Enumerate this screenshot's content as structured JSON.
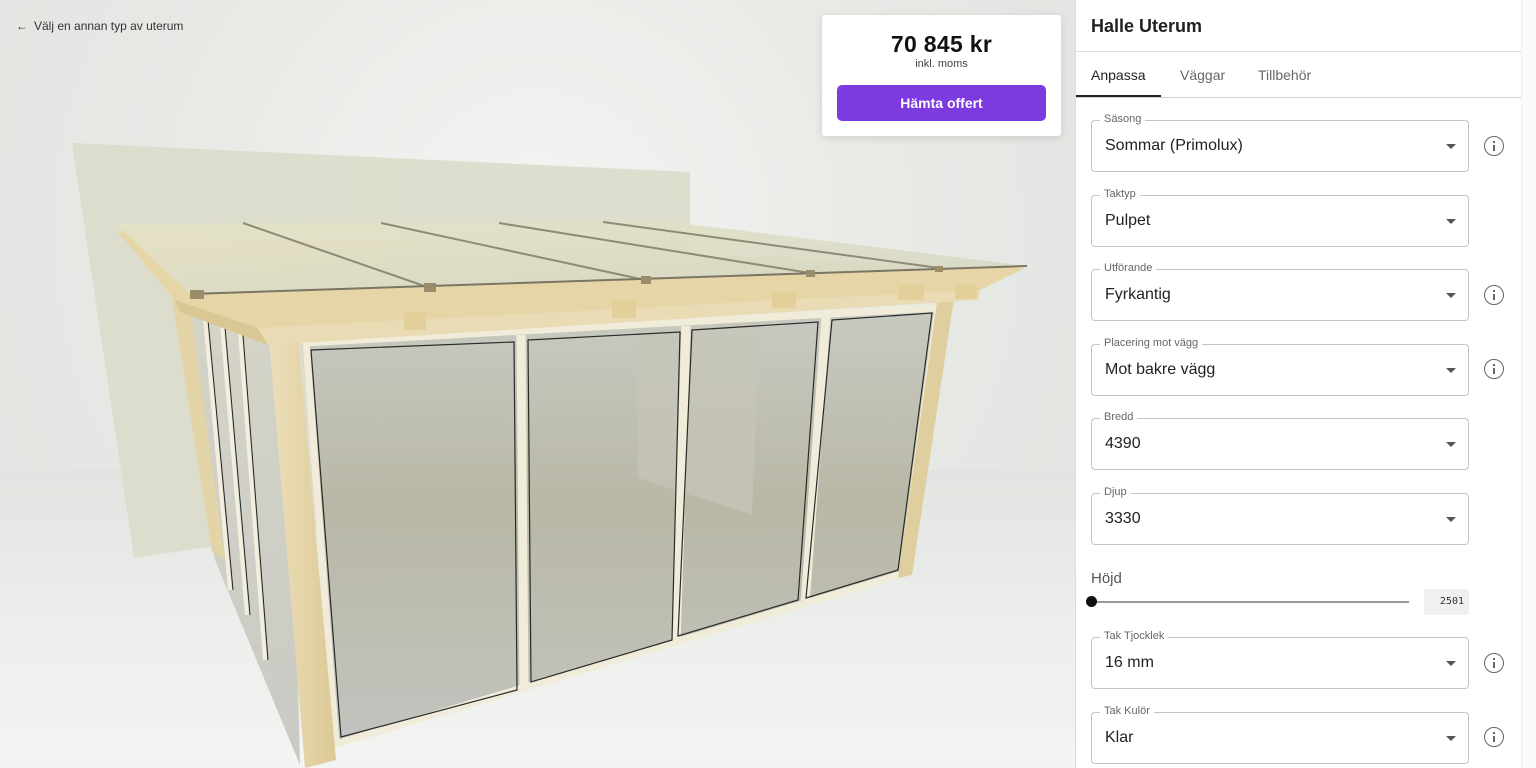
{
  "viewer": {
    "back_link": "Välj en annan typ av uterum"
  },
  "price_card": {
    "price": "70 845 kr",
    "vat_note": "inkl. moms",
    "offer_button": "Hämta offert"
  },
  "panel": {
    "title": "Halle Uterum",
    "tabs": [
      {
        "label": "Anpassa",
        "active": true
      },
      {
        "label": "Väggar",
        "active": false
      },
      {
        "label": "Tillbehör",
        "active": false
      }
    ],
    "fields": [
      {
        "label": "Säsong",
        "value": "Sommar (Primolux)",
        "info": true
      },
      {
        "label": "Taktyp",
        "value": "Pulpet",
        "info": false
      },
      {
        "label": "Utförande",
        "value": "Fyrkantig",
        "info": true
      },
      {
        "label": "Placering mot vägg",
        "value": "Mot bakre vägg",
        "info": true
      },
      {
        "label": "Bredd",
        "value": "4390",
        "info": false
      },
      {
        "label": "Djup",
        "value": "3330",
        "info": false
      }
    ],
    "height": {
      "label": "Höjd",
      "value": "2501",
      "slider_fraction": 0.0
    },
    "fields_after": [
      {
        "label": "Tak Tjocklek",
        "value": "16 mm",
        "info": true
      },
      {
        "label": "Tak Kulör",
        "value": "Klar",
        "info": true
      }
    ]
  },
  "colors": {
    "accent": "#7c3ae0",
    "wood": "#e6d7ad",
    "glass": "#c9cbbf"
  }
}
